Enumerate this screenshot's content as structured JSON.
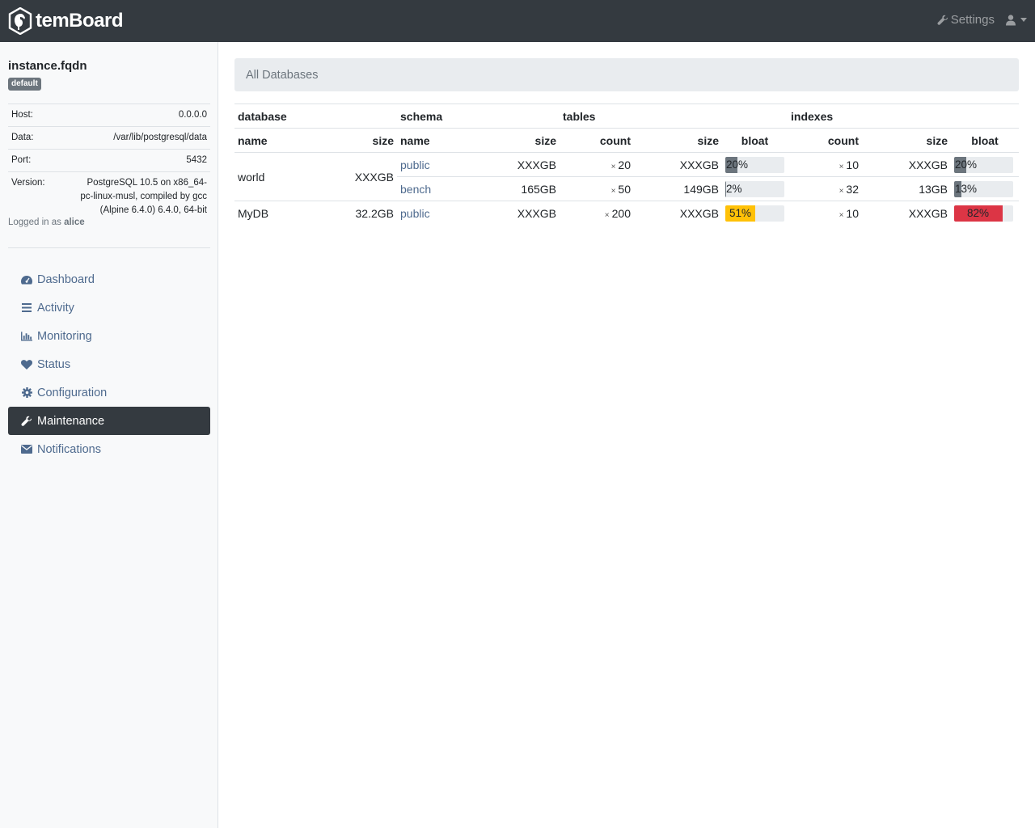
{
  "brand": {
    "name": "temBoard"
  },
  "topbar": {
    "settings_label": "Settings"
  },
  "instance": {
    "name": "instance.fqdn",
    "environment": "default",
    "info": [
      {
        "label": "Host:",
        "value": "0.0.0.0"
      },
      {
        "label": "Data:",
        "value": "/var/lib/postgresql/data"
      },
      {
        "label": "Port:",
        "value": "5432"
      },
      {
        "label": "Version:",
        "value": "PostgreSQL 10.5 on x86_64-pc-linux-musl, compiled by gcc (Alpine 6.4.0) 6.4.0, 64-bit"
      }
    ],
    "logged_prefix": "Logged in as",
    "user": "alice"
  },
  "nav": [
    {
      "label": "Dashboard",
      "icon": "dashboard-icon"
    },
    {
      "label": "Activity",
      "icon": "list-icon"
    },
    {
      "label": "Monitoring",
      "icon": "bar-chart-icon"
    },
    {
      "label": "Status",
      "icon": "heart-icon"
    },
    {
      "label": "Configuration",
      "icon": "gear-icon"
    },
    {
      "label": "Maintenance",
      "icon": "wrench-icon",
      "active": true
    },
    {
      "label": "Notifications",
      "icon": "envelope-icon"
    }
  ],
  "breadcrumb": "All Databases",
  "table": {
    "groups": {
      "database": "database",
      "schema": "schema",
      "tables": "tables",
      "indexes": "indexes"
    },
    "columns": {
      "name": "name",
      "size": "size",
      "count": "count",
      "bloat": "bloat"
    },
    "count_prefix": "×",
    "colors": {
      "bloat_ok": "#6c757d",
      "bloat_warn": "#ffc107",
      "bloat_danger": "#dc3545",
      "bar_bg": "#e9ecef",
      "link": "#4e6a8e"
    },
    "databases": [
      {
        "name": "world",
        "size": "XXXGB",
        "schemas": [
          {
            "name": "public",
            "size": "XXXGB",
            "tables_count": "20",
            "tables_size": "XXXGB",
            "tables_bloat": "20%",
            "tables_bloat_pct": 20,
            "tables_bloat_level": "ok",
            "indexes_count": "10",
            "indexes_size": "XXXGB",
            "indexes_bloat": "20%",
            "indexes_bloat_pct": 20,
            "indexes_bloat_level": "ok"
          },
          {
            "name": "bench",
            "size": "165GB",
            "tables_count": "50",
            "tables_size": "149GB",
            "tables_bloat": "2%",
            "tables_bloat_pct": 2,
            "tables_bloat_level": "ok",
            "indexes_count": "32",
            "indexes_size": "13GB",
            "indexes_bloat": "13%",
            "indexes_bloat_pct": 13,
            "indexes_bloat_level": "ok"
          }
        ]
      },
      {
        "name": "MyDB",
        "size": "32.2GB",
        "schemas": [
          {
            "name": "public",
            "size": "XXXGB",
            "tables_count": "200",
            "tables_size": "XXXGB",
            "tables_bloat": "51%",
            "tables_bloat_pct": 51,
            "tables_bloat_level": "warn",
            "indexes_count": "10",
            "indexes_size": "XXXGB",
            "indexes_bloat": "82%",
            "indexes_bloat_pct": 82,
            "indexes_bloat_level": "danger"
          }
        ]
      }
    ]
  }
}
